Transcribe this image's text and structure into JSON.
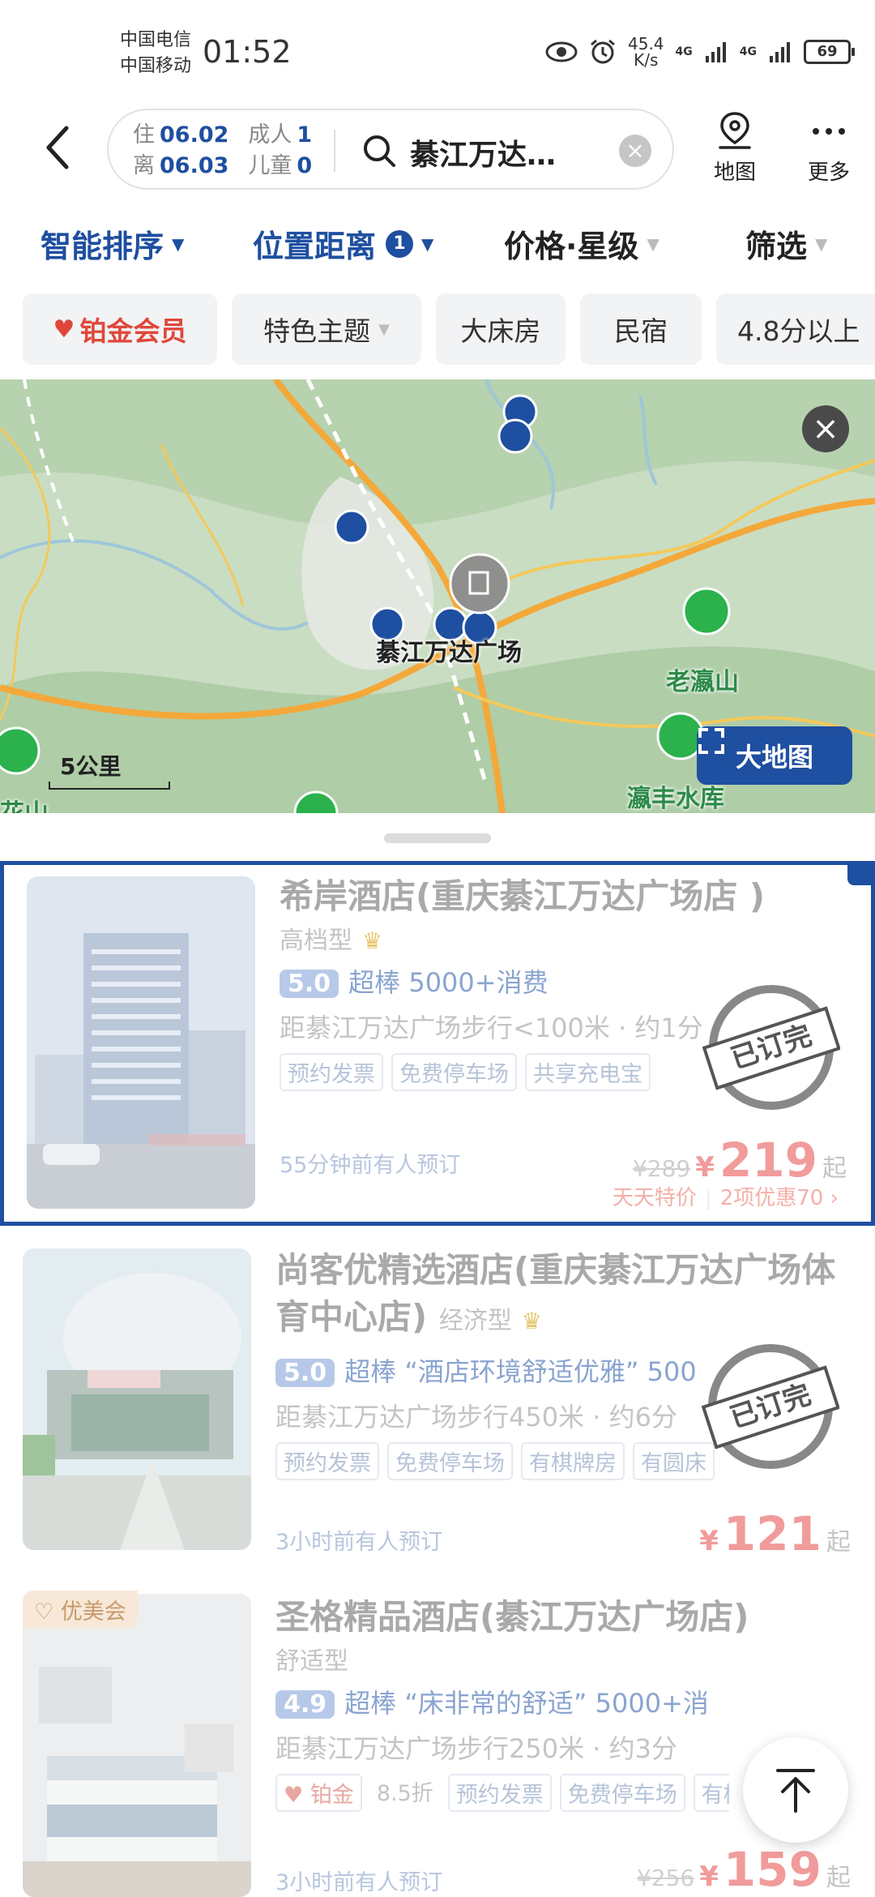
{
  "status": {
    "carrier1": "中国电信",
    "carrier2": "中国移动",
    "time": "01:52",
    "speed_value": "45.4",
    "speed_unit": "K/s",
    "net1": "4G",
    "net2": "4G",
    "battery": "69"
  },
  "search": {
    "checkin_label": "住",
    "checkin_date": "06.02",
    "checkout_label": "离",
    "checkout_date": "06.03",
    "adults_label": "成人",
    "adults": "1",
    "children_label": "儿童",
    "children": "0",
    "keyword": "綦江万达…"
  },
  "header": {
    "map_label": "地图",
    "more_label": "更多"
  },
  "sort": {
    "smart": "智能排序",
    "distance": "位置距离",
    "distance_badge": "1",
    "price_star": "价格·星级",
    "filter": "筛选"
  },
  "chips": [
    "铂金会员",
    "特色主题",
    "大床房",
    "民宿",
    "4.8分以上"
  ],
  "map": {
    "center_label": "綦江万达广场",
    "mountain1": "老瀛山",
    "reservoir": "瀛丰水库",
    "left_edge_label": "花山",
    "scale": "5公里",
    "bigmap_button": "大地图"
  },
  "hotels": [
    {
      "name": "希岸酒店(重庆綦江万达广场店 )",
      "tier": "高档型",
      "score": "5.0",
      "score_text": "超棒  5000+消费",
      "distance": "距綦江万达广场步行<100米 · 约1分",
      "tags": [
        "预约发票",
        "免费停车场",
        "共享充电宝"
      ],
      "recent": "55分钟前有人预订",
      "old_price": "¥289",
      "currency": "¥",
      "price": "219",
      "suffix": "起",
      "promo1": "天天特价",
      "promo2": "2项优惠70 ›",
      "stamp": "已订完"
    },
    {
      "name": "尚客优精选酒店(重庆綦江万达广场体育中心店)",
      "tier": "经济型",
      "score": "5.0",
      "score_text": "超棒 “酒店环境舒适优雅” 500",
      "distance": "距綦江万达广场步行450米 · 约6分",
      "tags": [
        "预约发票",
        "免费停车场",
        "有棋牌房",
        "有圆床"
      ],
      "recent": "3小时前有人预订",
      "currency": "¥",
      "price": "121",
      "suffix": "起",
      "stamp": "已订完"
    },
    {
      "member_tag": "优美会",
      "name": "圣格精品酒店(綦江万达广场店)",
      "tier": "舒适型",
      "score": "4.9",
      "score_text": "超棒 “床非常的舒适” 5000+消",
      "distance": "距綦江万达广场步行250米 · 约3分",
      "vip_label": "铂金",
      "discount": "8.5折",
      "tags": [
        "预约发票",
        "免费停车场",
        "有棋牌"
      ],
      "recent": "3小时前有人预订",
      "old_price": "¥256",
      "currency": "¥",
      "price": "159",
      "suffix": "起"
    }
  ],
  "colors": {
    "brand_blue": "#1e4fa0",
    "price_red": "#f19b9b",
    "vip_red": "#e0473a"
  }
}
